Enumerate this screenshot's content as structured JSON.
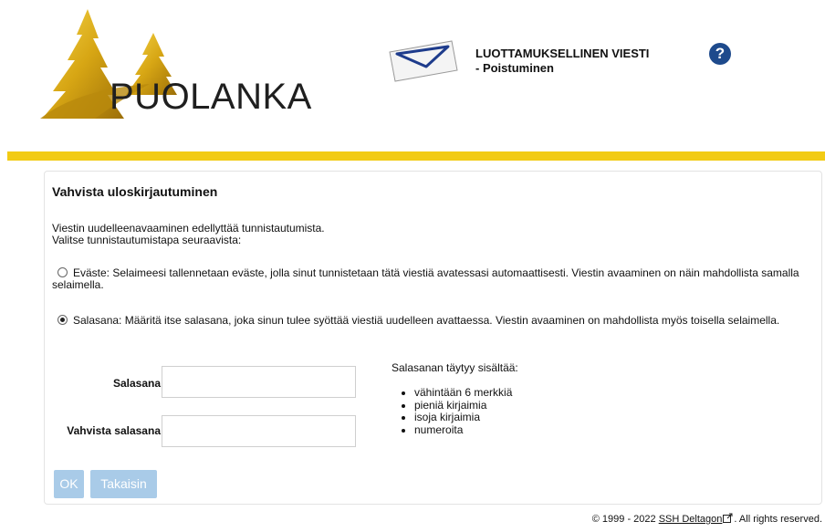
{
  "header": {
    "logo_text": "PUOLANKA",
    "title_line1": "LUOTTAMUKSELLINEN VIESTI",
    "title_line2": "- Poistuminen",
    "help_label": "?"
  },
  "colors": {
    "accent_bar": "#f2cb14",
    "button_bg": "#a9cbe8",
    "help_icon": "#1e4a8c",
    "logo_gold": "#d4a514"
  },
  "panel": {
    "title": "Vahvista uloskirjautuminen",
    "intro_line1": "Viestin uudelleenavaaminen edellyttää tunnistautumista.",
    "intro_line2": "Valitse tunnistautumistapa seuraavista:",
    "options": [
      {
        "text": "Eväste: Selaimeesi tallennetaan eväste, jolla sinut tunnistetaan tätä viestiä avatessasi automaattisesti. Viestin avaaminen on näin mahdollista samalla selaimella.",
        "checked": false
      },
      {
        "text": "Salasana: Määritä itse salasana, joka sinun tulee syöttää viestiä uudelleen avattaessa. Viestin avaaminen on mahdollista myös toisella selaimella.",
        "checked": true
      }
    ],
    "password_label": "Salasana",
    "confirm_label": "Vahvista salasana",
    "password_value": "",
    "confirm_value": "",
    "requirements_title": "Salasanan täytyy sisältää:",
    "requirements": [
      "vähintään 6 merkkiä",
      "pieniä kirjaimia",
      "isoja kirjaimia",
      "numeroita"
    ],
    "ok_label": "OK",
    "back_label": "Takaisin"
  },
  "footer": {
    "prefix": "© 1999 - 2022 ",
    "link_text": "SSH Deltagon",
    "suffix": ". All rights reserved."
  }
}
